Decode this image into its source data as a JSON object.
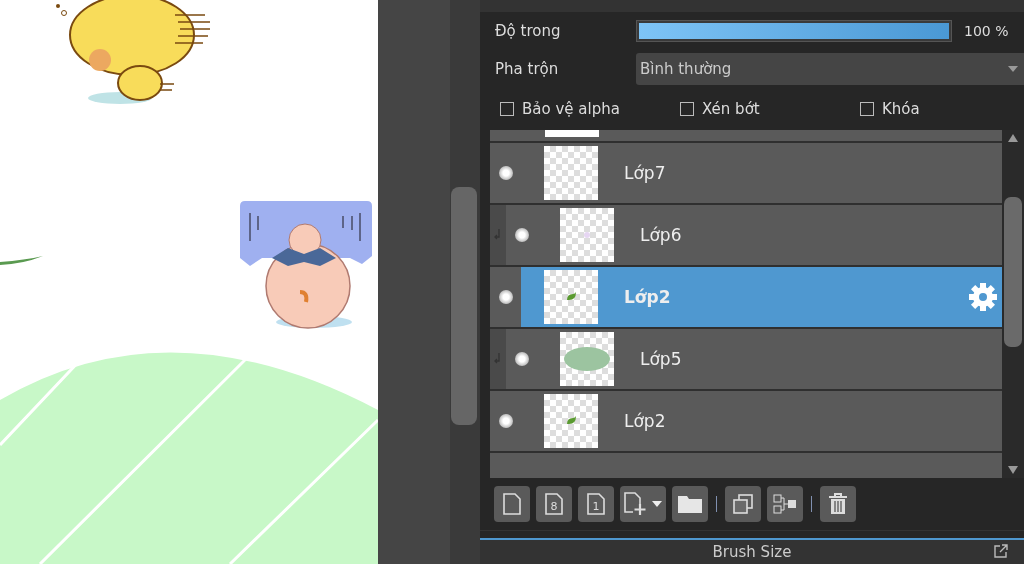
{
  "properties": {
    "opacity": {
      "label": "Độ trong",
      "level": 1,
      "reading": "100 %"
    },
    "blend": {
      "label": "Pha trộn",
      "value": "Bình thường"
    },
    "options": [
      {
        "label": "Bảo vệ alpha",
        "checked": false
      },
      {
        "label": "Xén bớt",
        "checked": false
      },
      {
        "label": "Khóa",
        "checked": false
      }
    ]
  },
  "layers": [
    {
      "name": "Lớp7",
      "kind": "empty",
      "visible": true,
      "clipped": false,
      "selected": false
    },
    {
      "name": "Lớp6",
      "kind": "speck",
      "visible": true,
      "clipped": true,
      "selected": false
    },
    {
      "name": "Lớp2",
      "kind": "leaf",
      "visible": true,
      "clipped": false,
      "selected": true
    },
    {
      "name": "Lớp5",
      "kind": "blob",
      "visible": true,
      "clipped": true,
      "selected": false
    },
    {
      "name": "Lớp2",
      "kind": "leaf",
      "visible": true,
      "clipped": false,
      "selected": false
    }
  ],
  "toolbar": [
    {
      "kind": "new"
    },
    {
      "kind": "new-8",
      "glyph": "8"
    },
    {
      "kind": "new-1",
      "glyph": "1"
    },
    {
      "kind": "add-menu"
    },
    {
      "kind": "folder"
    },
    {
      "kind": "sep"
    },
    {
      "kind": "duplicate"
    },
    {
      "kind": "merge"
    },
    {
      "kind": "sep"
    },
    {
      "kind": "delete"
    }
  ],
  "next_panel": {
    "title": "Brush Size"
  }
}
